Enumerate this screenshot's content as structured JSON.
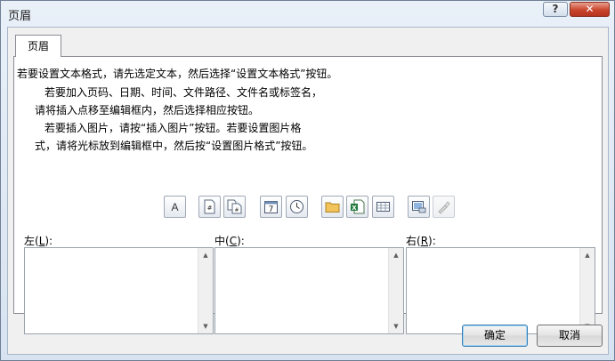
{
  "window": {
    "title": "页眉"
  },
  "titlebar": {
    "help_label": "?",
    "close_label": "✕"
  },
  "tabs": [
    {
      "label": "页眉"
    }
  ],
  "instructions": {
    "line1": "若要设置文本格式，请先选定文本，然后选择“设置文本格式”按钮。",
    "line2": "若要加入页码、日期、时间、文件路径、文件名或标签名，",
    "line3": "请将插入点移至编辑框内，然后选择相应按钮。",
    "line4": "若要插入图片，请按“插入图片”按钮。若要设置图片格",
    "line5": "式，请将光标放到编辑框中，然后按“设置图片格式”按钮。"
  },
  "toolbar": {
    "buttons": [
      {
        "name": "format-text",
        "icon": "letter-a-icon",
        "text": "A"
      },
      {
        "name": "insert-page-number",
        "icon": "page-number-icon",
        "text": ""
      },
      {
        "name": "insert-number-of-pages",
        "icon": "number-of-pages-icon",
        "text": ""
      },
      {
        "name": "insert-date",
        "icon": "calendar-icon",
        "text": "7"
      },
      {
        "name": "insert-time",
        "icon": "clock-icon",
        "text": ""
      },
      {
        "name": "insert-file-path",
        "icon": "folder-icon",
        "text": ""
      },
      {
        "name": "insert-file-name",
        "icon": "excel-file-icon",
        "text": ""
      },
      {
        "name": "insert-sheet-name",
        "icon": "sheet-grid-icon",
        "text": ""
      },
      {
        "name": "insert-picture",
        "icon": "picture-icon",
        "text": ""
      },
      {
        "name": "format-picture",
        "icon": "format-picture-icon",
        "text": "",
        "disabled": true
      }
    ]
  },
  "sections": {
    "left": {
      "label_prefix": "左(",
      "accel": "L",
      "label_suffix": "):",
      "value": ""
    },
    "center": {
      "label_prefix": "中(",
      "accel": "C",
      "label_suffix": "):",
      "value": ""
    },
    "right": {
      "label_prefix": "右(",
      "accel": "R",
      "label_suffix": "):",
      "value": ""
    }
  },
  "footer": {
    "ok_label": "确定",
    "cancel_label": "取消"
  },
  "colors": {
    "accent": "#3c7fb1",
    "close": "#c9442c",
    "frame": "#d7e3f1"
  }
}
